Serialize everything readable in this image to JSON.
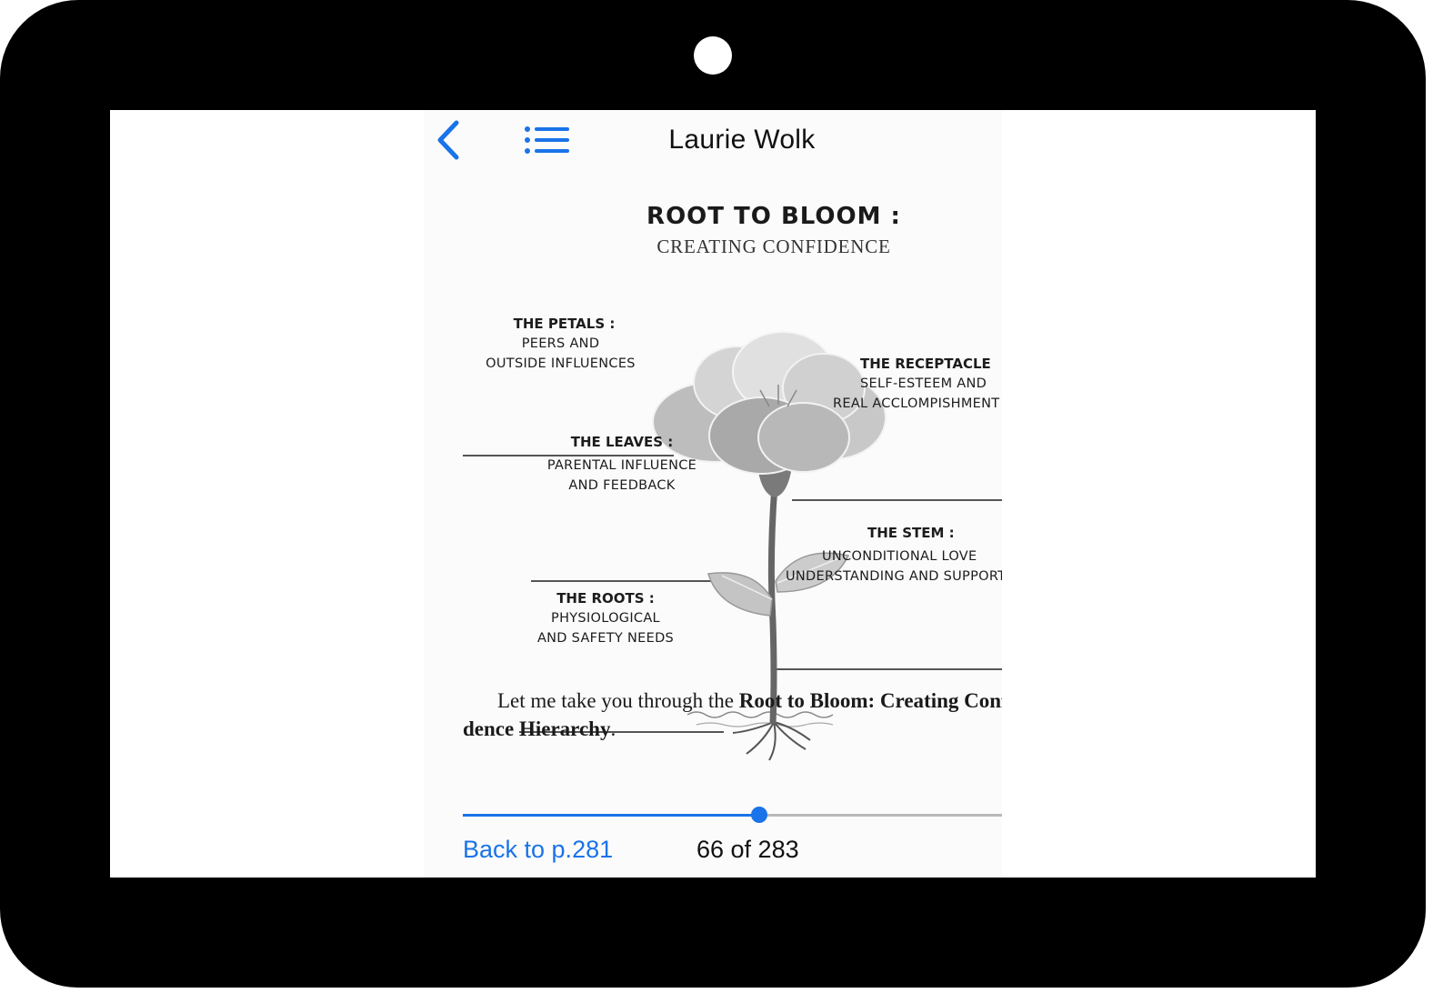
{
  "reader": {
    "title": "Laurie Wolk",
    "back_icon": "chevron-left-icon",
    "toc_icon": "list-icon",
    "accent_color": "#1a73e8"
  },
  "figure": {
    "title": "ROOT TO BLOOM :",
    "subtitle": "CREATING CONFIDENCE",
    "labels": {
      "petals": {
        "heading": "THE PETALS :",
        "line1": "PEERS AND",
        "line2": "OUTSIDE  INFLUENCES"
      },
      "receptacle": {
        "heading": "THE RECEPTACLE",
        "line1": "SELF-ESTEEM AND",
        "line2": "REAL  ACCLOMPISHMENT"
      },
      "leaves": {
        "heading": "THE LEAVES :",
        "line1": "PARENTAL  INFLUENCE",
        "line2": "AND FEEDBACK"
      },
      "stem": {
        "heading": "THE STEM :",
        "line1": "UNCONDITIONAL LOVE",
        "line2": "UNDERSTANDING AND SUPPORT"
      },
      "roots": {
        "heading": "THE ROOTS :",
        "line1": "PHYSIOLOGICAL",
        "line2": "AND SAFETY NEEDS"
      }
    }
  },
  "body": {
    "line1_plain": "Let me take you through the ",
    "line1_bold": "Root to Bloom: Creating Confi-",
    "line2_bold": "dence Hierarchy",
    "line2_end": "."
  },
  "footer": {
    "progress": 0.543,
    "back_link": "Back to p.281",
    "page_count": "66 of 283"
  }
}
